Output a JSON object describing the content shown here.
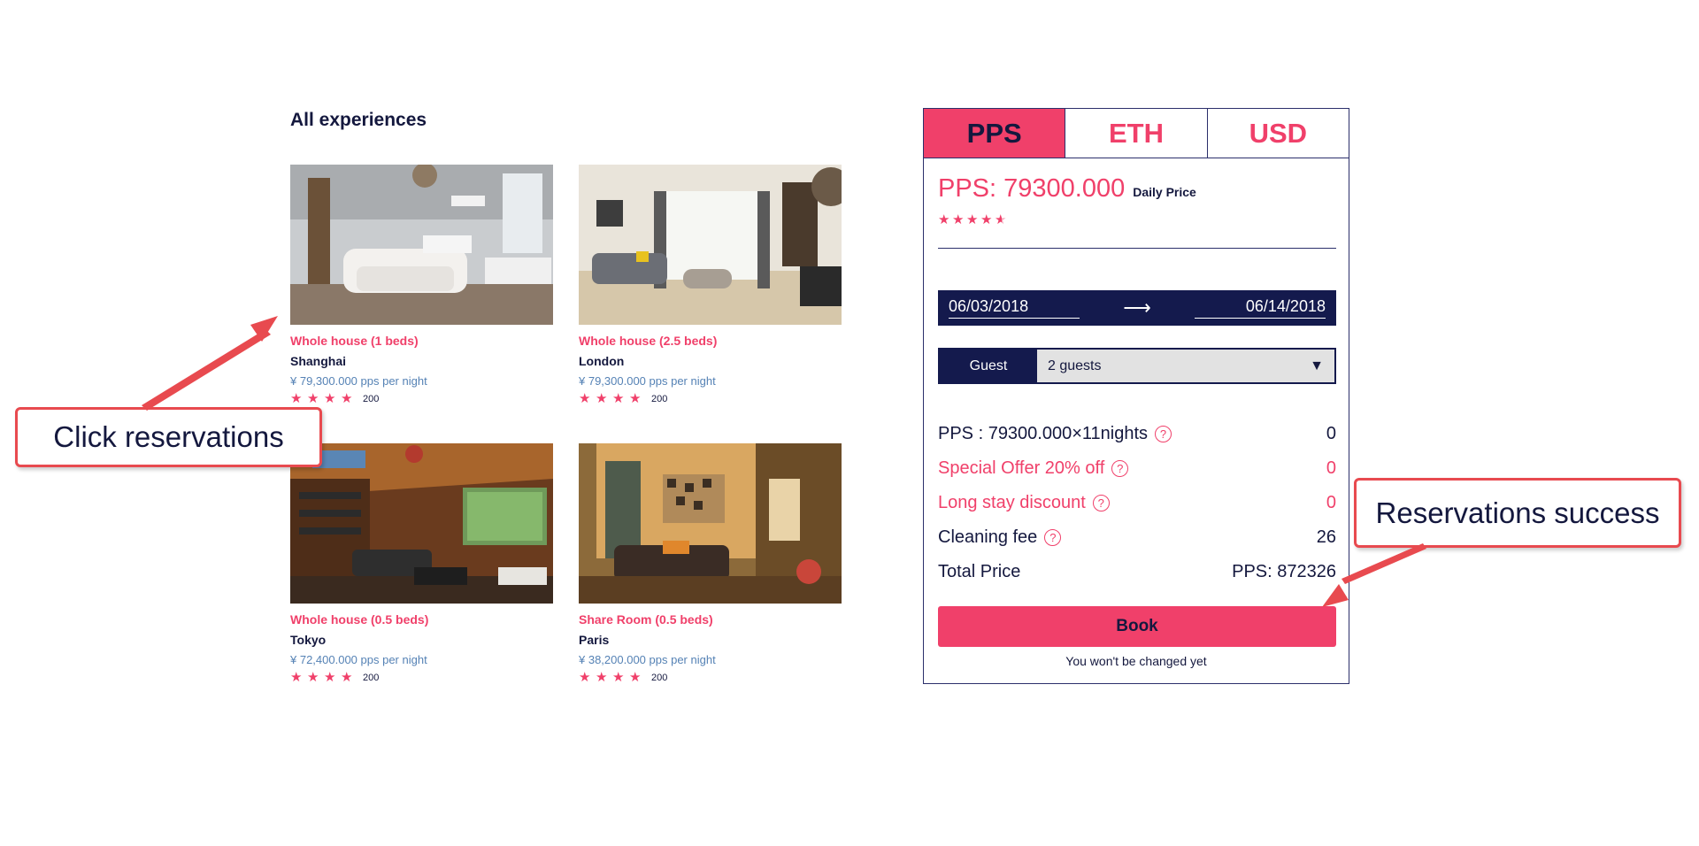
{
  "section_title": "All experiences",
  "listings": [
    {
      "type": "Whole house (1 beds)",
      "city": "Shanghai",
      "price": "¥ 79,300.000 pps per night",
      "rating_stars": 4,
      "reviews": "200"
    },
    {
      "type": "Whole house (2.5 beds)",
      "city": "London",
      "price": "¥ 79,300.000 pps per night",
      "rating_stars": 4,
      "reviews": "200"
    },
    {
      "type": "Whole house (0.5 beds)",
      "city": "Tokyo",
      "price": "¥ 72,400.000 pps per night",
      "rating_stars": 4,
      "reviews": "200"
    },
    {
      "type": "Share Room (0.5 beds)",
      "city": "Paris",
      "price": "¥ 38,200.000 pps per night",
      "rating_stars": 4,
      "reviews": "200"
    }
  ],
  "booking": {
    "tabs": [
      "PPS",
      "ETH",
      "USD"
    ],
    "active_tab": "PPS",
    "price": "PPS: 79300.000",
    "price_label": "Daily Price",
    "rating": 4.5,
    "check_in": "06/03/2018",
    "check_out": "06/14/2018",
    "guest_label": "Guest",
    "guest_value": "2 guests",
    "fees": [
      {
        "label": "PPS : 79300.000×11nights",
        "value": "0"
      },
      {
        "label": "Special Offer 20% off",
        "value": "0"
      },
      {
        "label": "Long stay discount",
        "value": "0"
      },
      {
        "label": "Cleaning fee",
        "value": "26"
      },
      {
        "label": "Total Price",
        "value": "PPS: 872326"
      }
    ],
    "book_label": "Book",
    "note": "You won't be changed yet"
  },
  "annotations": {
    "left": "Click reservations",
    "right": "Reservations success"
  },
  "colors": {
    "accent": "#f0406a",
    "navy": "#141a4d",
    "callout_border": "#e84a4f"
  }
}
